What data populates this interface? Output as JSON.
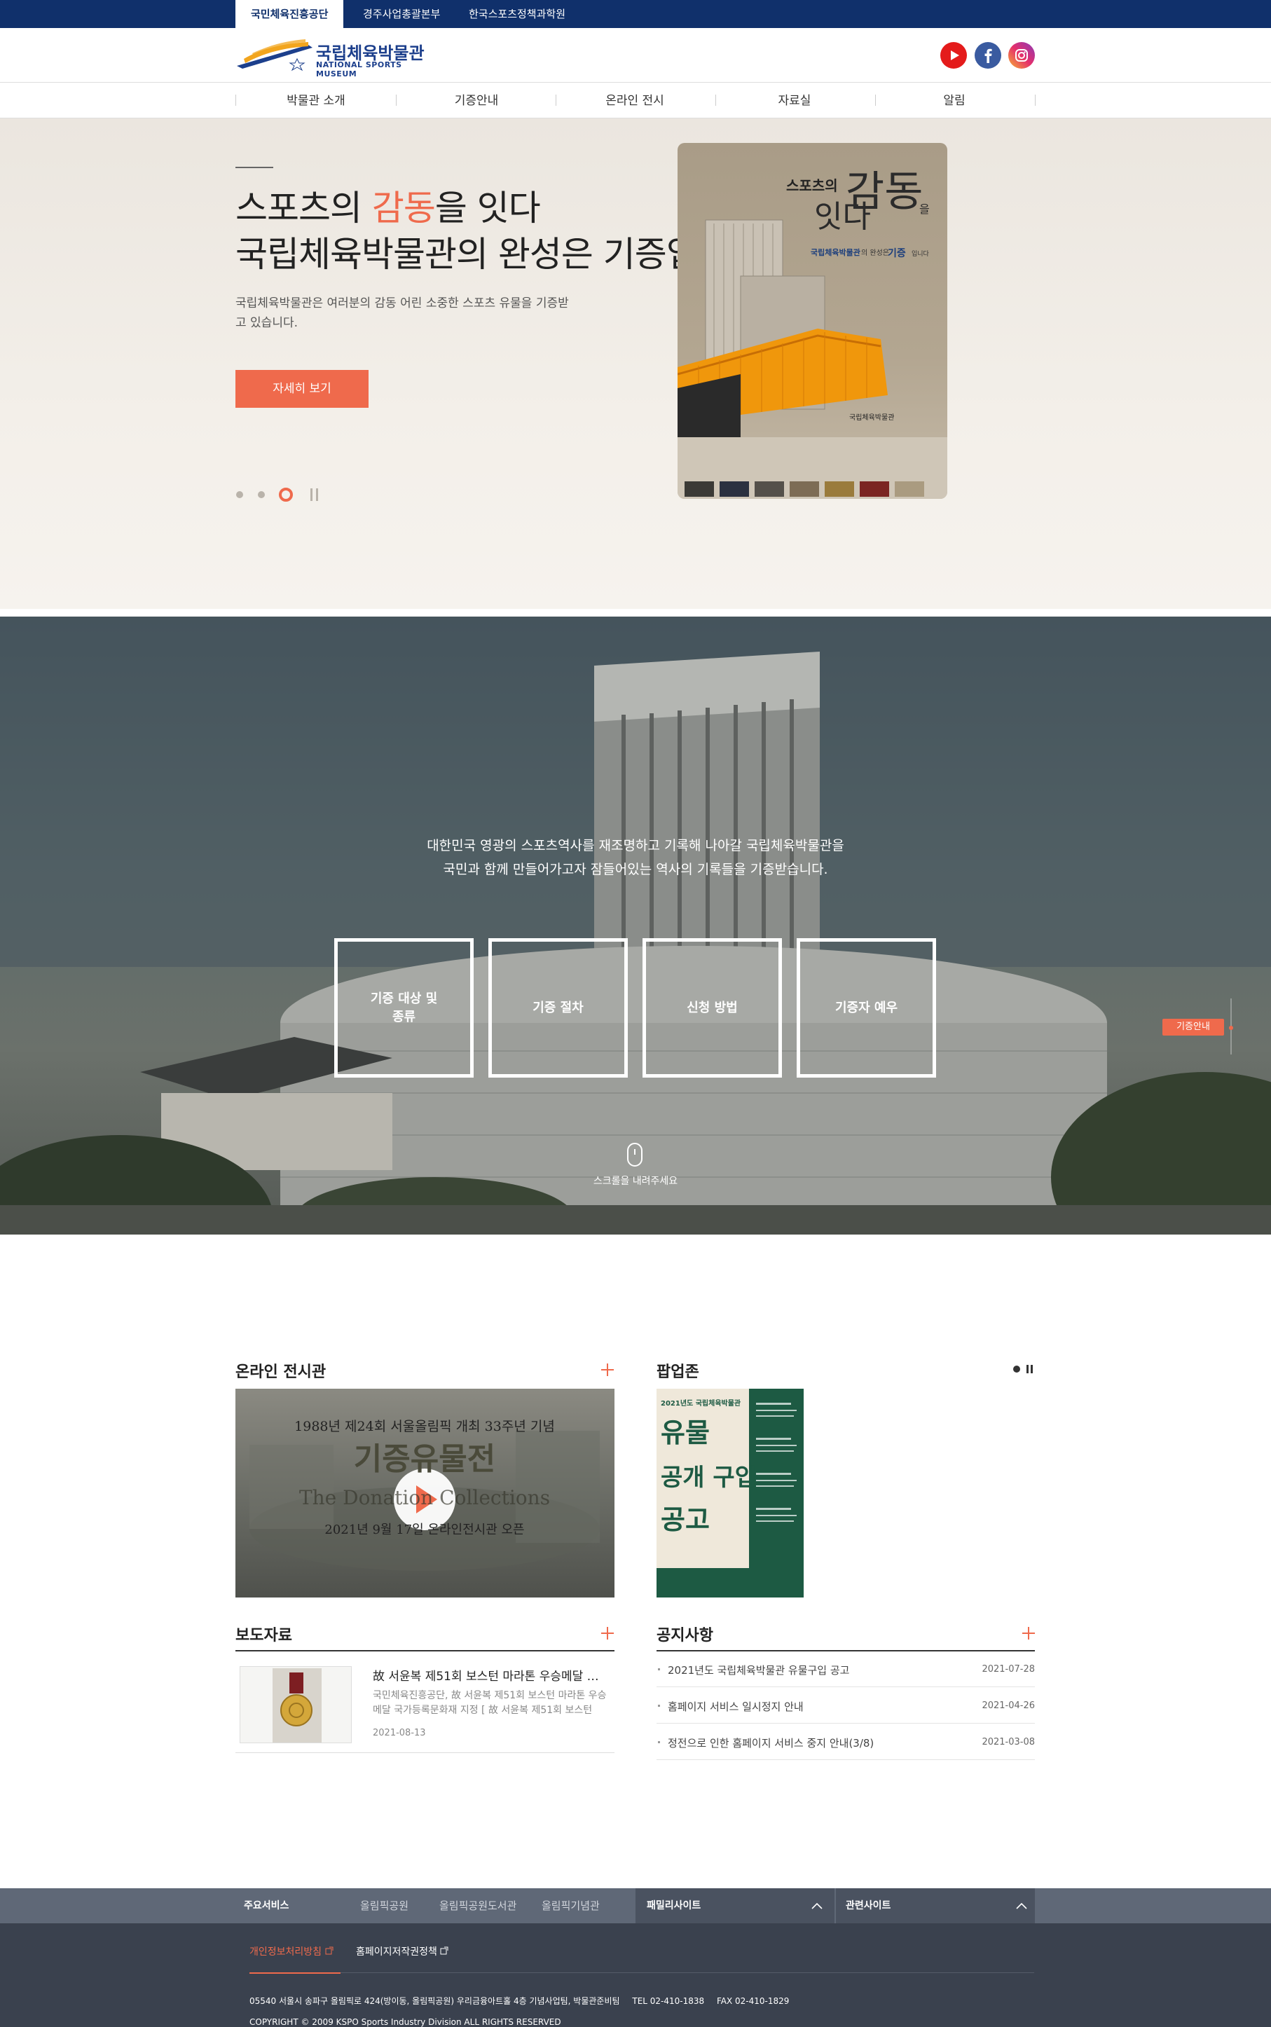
{
  "topbar": {
    "tabs": [
      "국민체육진흥공단",
      "경주사업총괄본부",
      "한국스포츠정책과학원"
    ]
  },
  "header": {
    "logo_ko": "국립체육박물관",
    "logo_en": "NATIONAL SPORTS MUSEUM",
    "sns": [
      "youtube-icon",
      "facebook-icon",
      "instagram-icon"
    ]
  },
  "gnb": [
    "박물관 소개",
    "기증안내",
    "온라인 전시",
    "자료실",
    "알림"
  ],
  "hero": {
    "title_a": "스포츠의 ",
    "title_hl": "감동",
    "title_b": "을 잇다",
    "title_line2": "국립체육박물관의 완성은 기증입니다.",
    "desc": "국립체육박물관은 여러분의 감동 어린 소중한 스포츠 유물을 기증받고 있습니다.",
    "button": "자세히 보기",
    "poster": {
      "t1": "스포츠의",
      "t2": "감동",
      "t3": "을",
      "t4": "잇다",
      "sub_a": "국립체육박물관",
      "sub_b": "의 완성은",
      "sub_c": "기증",
      "sub_d": "입니다",
      "sign": "국립체육박물관"
    }
  },
  "guide": {
    "intro1": "대한민국 영광의 스포츠역사를 재조명하고 기록해 나아갈 국립체육박물관을",
    "intro2": "국민과 함께 만들어가고자 잠들어있는 역사의 기록들을 기증받습니다.",
    "boxes": [
      "기증 대상 및\n종류",
      "기증 절차",
      "신청 방법",
      "기증자 예우"
    ],
    "side_tag": "기증안내",
    "scroll": "스크롤을 내려주세요"
  },
  "online": {
    "title": "온라인 전시관",
    "video_l1": "1988년 제24회 서울올림픽 개최 33주년 기념",
    "video_l2": "기증유물전",
    "video_l3": "The Donation Collections",
    "video_l4": "2021년 9월 17일  온라인전시관 오픈"
  },
  "popupzone": {
    "title": "팝업존",
    "poster_top": "2021년도 국립체육박물관",
    "poster_main": [
      "유물",
      "공개 구입",
      "공고"
    ]
  },
  "press": {
    "title": "보도자료",
    "item_title": "故 서윤복 제51회 보스턴 마라톤 우승메달 …",
    "item_desc": "국민체육진흥공단, 故 서윤복 제51회 보스턴 마라톤 우승메달 국가등록문화재 지정 [ 故 서윤복 제51회 보스턴",
    "item_date": "2021-08-13"
  },
  "notice": {
    "title": "공지사항",
    "items": [
      {
        "t": "2021년도 국립체육박물관 유물구입 공고",
        "d": "2021-07-28"
      },
      {
        "t": "홈페이지 서비스 일시정지 안내",
        "d": "2021-04-26"
      },
      {
        "t": "정전으로 인한 홈페이지 서비스 중지 안내(3/8)",
        "d": "2021-03-08"
      }
    ]
  },
  "footer": {
    "main_service": "주요서비스",
    "links": [
      "올림픽공원",
      "올림픽공원도서관",
      "올림픽기념관"
    ],
    "family": "패밀리사이트",
    "related": "관련사이트",
    "privacy": "개인정보처리방침",
    "copyright_policy": "홈페이지저작권정책",
    "address": "05540 서울시 송파구 올림픽로 424(방이동, 올림픽공원) 우리금융아트홀 4층 기념사업팀, 박물관준비팀",
    "tel": "TEL 02-410-1838",
    "fax": "FAX 02-410-1829",
    "copyright": "COPYRIGHT © 2009 KSPO Sports Industry Division ALL RIGHTS RESERVED"
  },
  "colors": {
    "navy": "#10306b",
    "accent": "#ef6a4c"
  }
}
